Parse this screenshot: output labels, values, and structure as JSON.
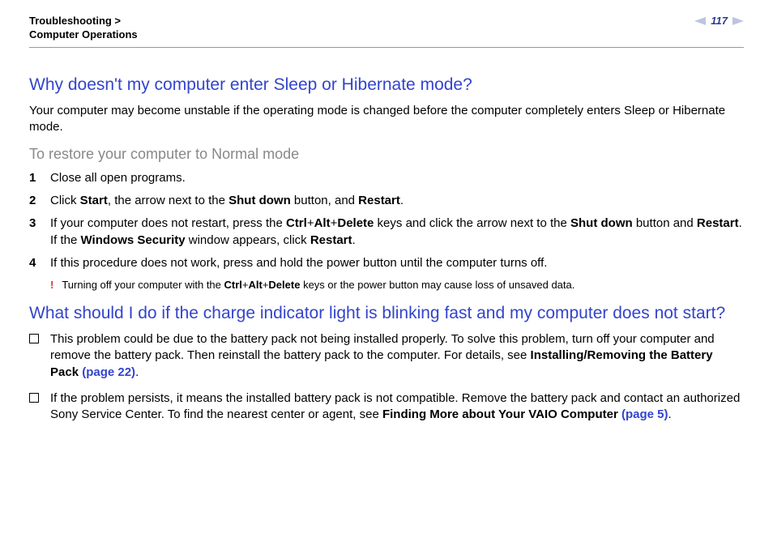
{
  "header": {
    "breadcrumb_line1": "Troubleshooting >",
    "breadcrumb_line2": "Computer Operations",
    "page_number": "117"
  },
  "section1": {
    "heading": "Why doesn't my computer enter Sleep or Hibernate mode?",
    "intro": "Your computer may become unstable if the operating mode is changed before the computer completely enters Sleep or Hibernate mode.",
    "subhead": "To restore your computer to Normal mode",
    "steps": [
      {
        "n": "1",
        "html": "Close all open programs."
      },
      {
        "n": "2",
        "html": "Click <b>Start</b>, the arrow next to the <b>Shut down</b> button, and <b>Restart</b>."
      },
      {
        "n": "3",
        "html": "If your computer does not restart, press the <b>Ctrl</b>+<b>Alt</b>+<b>Delete</b> keys and click the arrow next to the <b>Shut down</b> button and <b>Restart</b>.<br>If the <b>Windows Security</b> window appears, click <b>Restart</b>."
      },
      {
        "n": "4",
        "html": "If this procedure does not work, press and hold the power button until the computer turns off."
      }
    ],
    "warning": {
      "mark": "!",
      "html": "Turning off your computer with the <b>Ctrl</b>+<b>Alt</b>+<b>Delete</b> keys or the power button may cause loss of unsaved data."
    }
  },
  "section2": {
    "heading": "What should I do if the charge indicator light is blinking fast and my computer does not start?",
    "bullets": [
      {
        "html": "This problem could be due to the battery pack not being installed properly. To solve this problem, turn off your computer and remove the battery pack. Then reinstall the battery pack to the computer. For details, see <b>Installing/Removing the Battery Pack <span class=\"link\">(page 22)</span></b>."
      },
      {
        "html": "If the problem persists, it means the installed battery pack is not compatible. Remove the battery pack and contact an authorized Sony Service Center. To find the nearest center or agent, see <b>Finding More about Your VAIO Computer <span class=\"link\">(page 5)</span></b>."
      }
    ]
  }
}
